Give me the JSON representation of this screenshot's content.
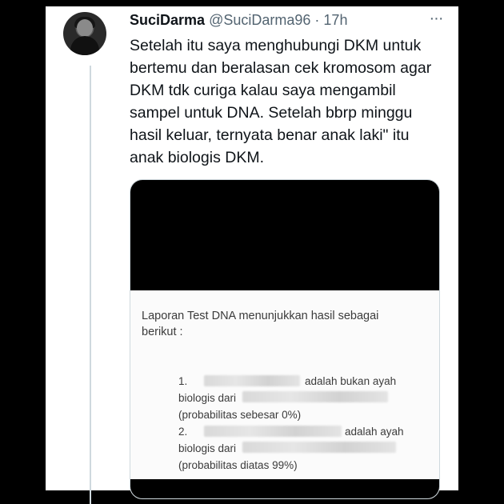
{
  "tweet": {
    "author_name": "SuciDarma",
    "author_handle": "@SuciDarma96",
    "separator": "·",
    "time": "17h",
    "more_label": "···",
    "text_lines": [
      "Setelah itu saya menghubungi DKM untuk",
      "bertemu dan beralasan cek kromosom agar",
      "DKM tdk curiga kalau saya mengambil",
      "sampel untuk DNA. Setelah bbrp minggu",
      "hasil keluar, ternyata benar anak laki\" itu",
      "anak biologis DKM."
    ]
  },
  "media": {
    "intro_lines": [
      "Laporan Test DNA menunjukkan hasil sebagai",
      "berikut :"
    ],
    "items": [
      {
        "number": "1.",
        "text_after_name": "adalah bukan ayah",
        "line2": "biologis dari",
        "line3": "(probabilitas sebesar 0%)"
      },
      {
        "number": "2.",
        "text_after_name": "adalah ayah",
        "line2": "biologis dari",
        "line3": "(probabilitas diatas 99%)"
      }
    ]
  }
}
